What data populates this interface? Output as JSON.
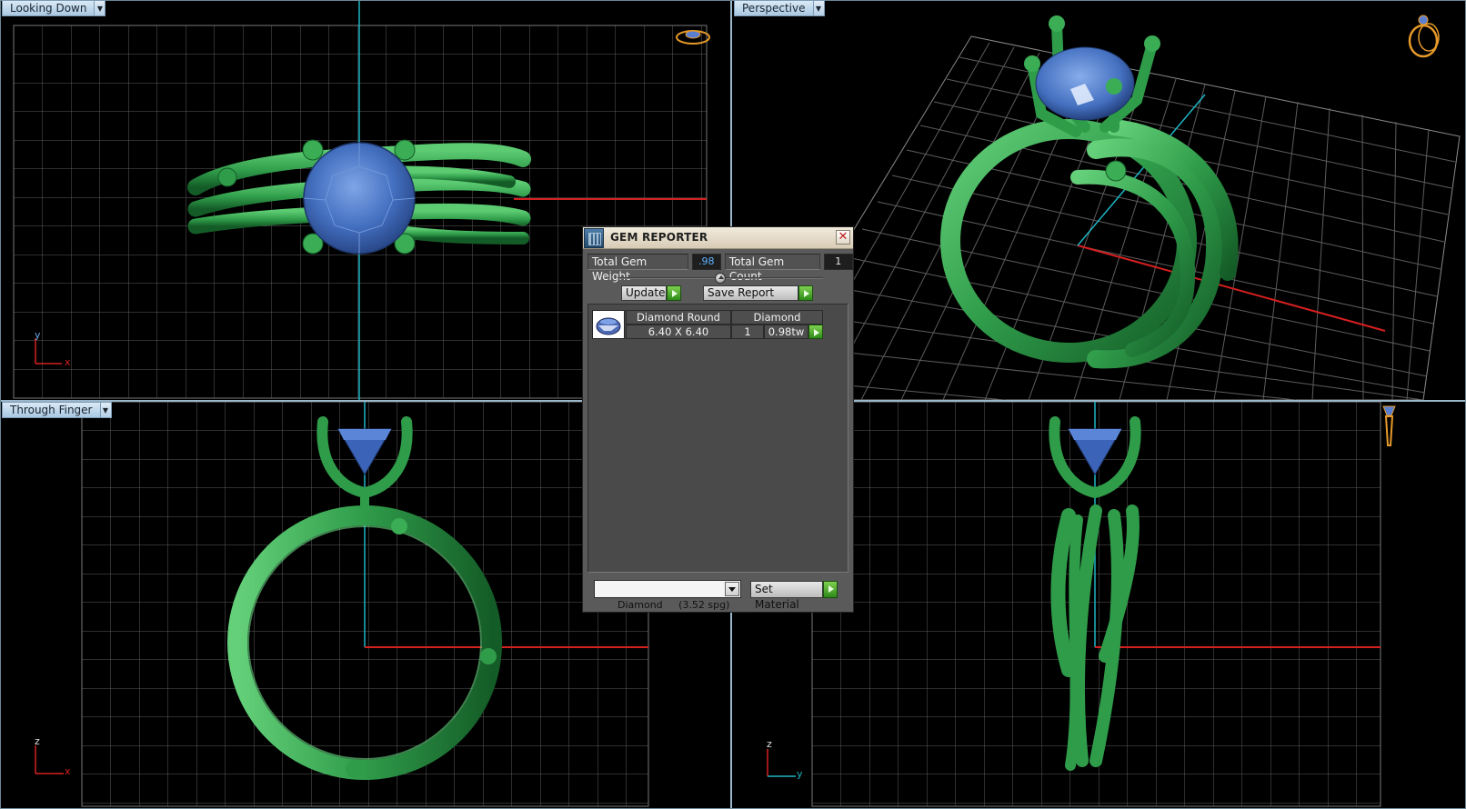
{
  "viewports": {
    "top_left": {
      "label": "Looking Down",
      "axis_h": "x",
      "axis_v": "y"
    },
    "top_right": {
      "label": "Perspective"
    },
    "bottom_left": {
      "label": "Through Finger",
      "axis_h": "x",
      "axis_v": "z"
    },
    "bottom_right": {
      "axis_h": "y",
      "axis_v": "z"
    }
  },
  "gem_reporter": {
    "title": "GEM REPORTER",
    "close_glyph": "✕",
    "total_weight_label": "Total Gem Weight",
    "total_weight_value": ".98",
    "total_count_label": "Total Gem Count",
    "total_count_value": "1",
    "update_label": "Update",
    "save_report_label": "Save Report",
    "gems": [
      {
        "shape": "Diamond Round",
        "material": "Diamond",
        "size": "6.40 X 6.40",
        "count": "1",
        "weight": "0.98tw"
      }
    ],
    "material_select": "Diamond     (3.52 spg)",
    "set_material_label": "Set Material"
  },
  "colors": {
    "metal": "#2f9c4a",
    "gem": "#4a78c8",
    "grid": "#5d5d5d",
    "axis_x": "#d62020",
    "axis_v": "#1fb5c4",
    "gizmo": "#e69a2a"
  }
}
